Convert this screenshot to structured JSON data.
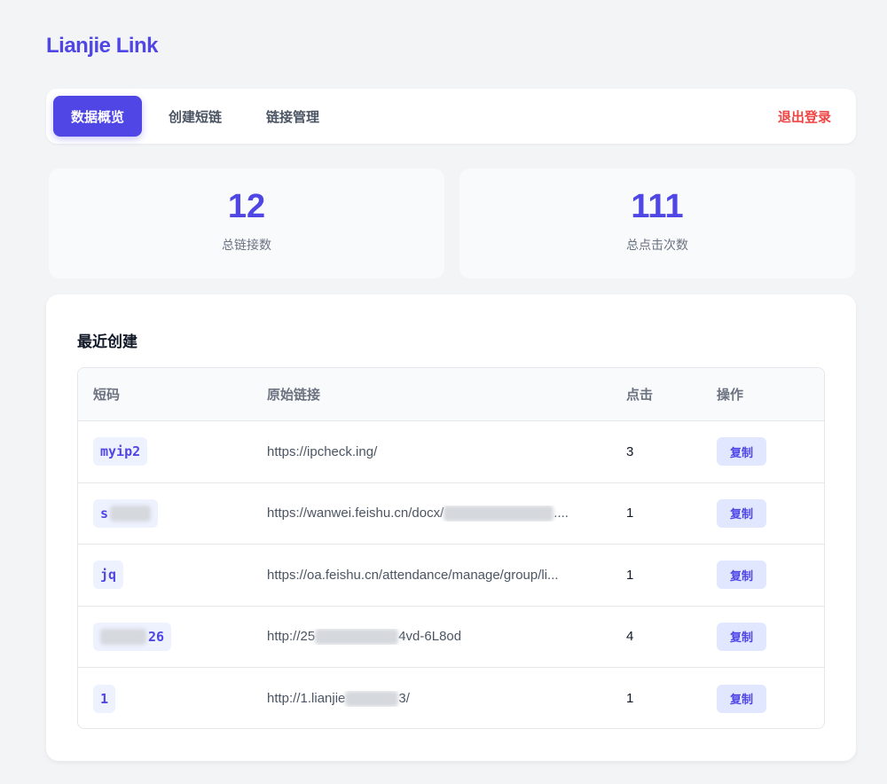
{
  "brand": "Lianjie Link",
  "nav": {
    "overview": "数据概览",
    "create": "创建短链",
    "manage": "链接管理",
    "logout": "退出登录"
  },
  "stats": {
    "total_links": "12",
    "total_links_label": "总链接数",
    "total_clicks": "111",
    "total_clicks_label": "总点击次数"
  },
  "recent": {
    "title": "最近创建",
    "columns": {
      "code": "短码",
      "url": "原始链接",
      "clicks": "点击",
      "action": "操作"
    },
    "rows": [
      {
        "code": "myip2",
        "url": "https://ipcheck.ing/",
        "clicks": "3",
        "action": "复制"
      },
      {
        "code": "s",
        "url": "https://wanwei.feishu.cn/docx/",
        "clicks": "1",
        "action": "复制"
      },
      {
        "code": "jq",
        "url": "https://oa.feishu.cn/attendance/manage/group/li...",
        "clicks": "1",
        "action": "复制"
      },
      {
        "code": "26",
        "url_start": "http://25",
        "url_end": "4vd-6L8od",
        "clicks": "4",
        "action": "复制"
      },
      {
        "code": "1",
        "url_start": "http://1.lianjie",
        "url_end": "3/",
        "clicks": "1",
        "action": "复制"
      }
    ]
  },
  "colors": {
    "accent": "#4f46e5",
    "logout": "#ef4444",
    "page_bg": "#f3f4f6"
  }
}
